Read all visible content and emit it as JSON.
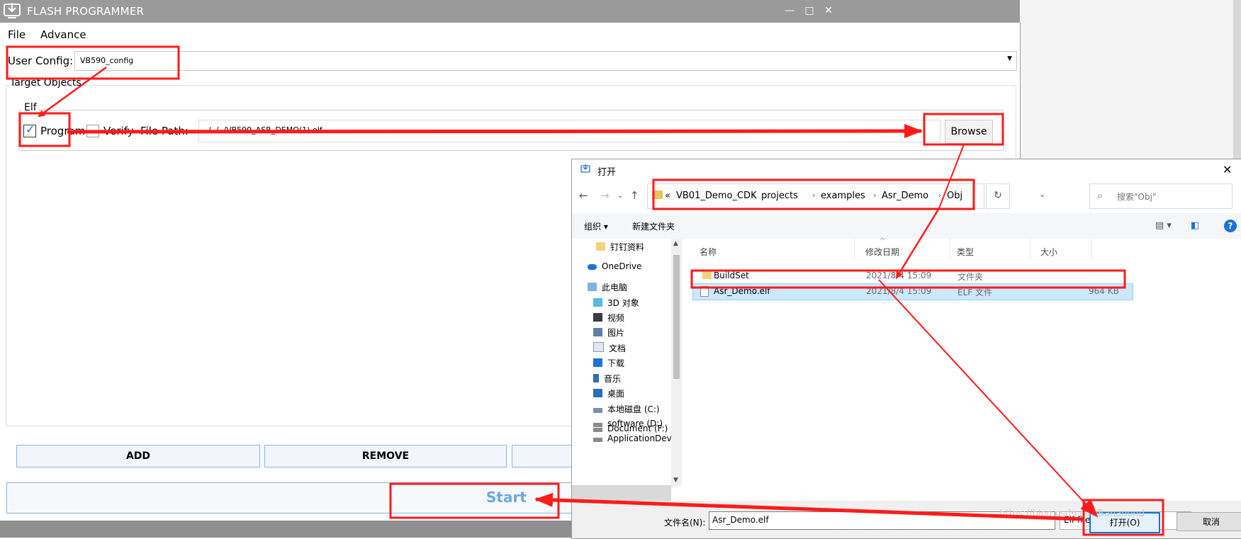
{
  "app": {
    "title": "FLASH PROGRAMMER",
    "window_controls": {
      "minimize": "—",
      "maximize": "□",
      "close": "✕"
    },
    "menu": [
      "File",
      "Advance"
    ],
    "user_config_label": "User Config:",
    "user_config_value": "VB590_config",
    "target_objects_label": "Target Objects",
    "elf_group_label": "Elf",
    "program_label": "Program",
    "program_checked": true,
    "verify_label": "Verify",
    "verify_checked": false,
    "file_path_label": "File Path:",
    "file_path_value": "../../../VB590_ASR_DEMO(1).elf",
    "browse_label": "Browse",
    "add_label": "ADD",
    "remove_label": "REMOVE",
    "start_label": "Start"
  },
  "dialog": {
    "title": "打开",
    "close": "✕",
    "breadcrumb": [
      "«",
      "VB01_Demo_CDK",
      "projects",
      "examples",
      "Asr_Demo",
      "Obj"
    ],
    "search_placeholder": "搜索\"Obj\"",
    "toolbar": {
      "organize": "组织 ▾",
      "new_folder": "新建文件夹",
      "help": "?"
    },
    "nav_items": [
      "钉钉资料",
      "OneDrive",
      "此电脑",
      "3D 对象",
      "视频",
      "图片",
      "文档",
      "下载",
      "音乐",
      "桌面",
      "本地磁盘 (C:)",
      "software (D:)",
      "ApplicationDev",
      "Document (F:)"
    ],
    "columns": [
      "名称",
      "修改日期",
      "类型",
      "大小"
    ],
    "files": [
      {
        "name": "BuildSet",
        "date": "2021/8/4 15:09",
        "type": "文件夹",
        "size": ""
      },
      {
        "name": "Asr_Demo.elf",
        "date": "2021/8/4 15:09",
        "type": "ELF 文件",
        "size": "964 KB"
      }
    ],
    "filename_label": "文件名(N):",
    "filename_value": "Asr_Demo.elf",
    "filetype_value": "Elf files (*.elf)",
    "open_label": "打开(O)",
    "cancel_label": "取消"
  },
  "watermark": "https://blog.csdn.net/Bananond",
  "colors": {
    "annotation": "#ff1a1a",
    "accent": "#1a73d9",
    "selection": "#cce8ff"
  }
}
